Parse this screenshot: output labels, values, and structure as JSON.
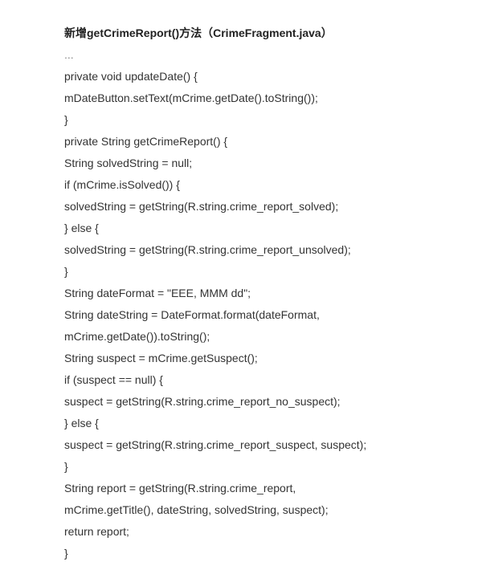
{
  "title": "新增getCrimeReport()方法（CrimeFragment.java）",
  "code": {
    "l0": "...",
    "l1": "private void updateDate() {",
    "l2": " mDateButton.setText(mCrime.getDate().toString());",
    "l3": "}",
    "l4": "private String getCrimeReport() {",
    "l5": " String solvedString = null;",
    "l6": " if (mCrime.isSolved()) {",
    "l7": " solvedString = getString(R.string.crime_report_solved);",
    "l8": " } else {",
    "l9": " solvedString = getString(R.string.crime_report_unsolved);",
    "l10": "}",
    "l11": " String dateFormat = \"EEE, MMM dd\";",
    "l12": " String dateString = DateFormat.format(dateFormat,",
    "l13": "mCrime.getDate()).toString();",
    "l14": " String suspect = mCrime.getSuspect();",
    "l15": " if (suspect == null) {",
    "l16": " suspect = getString(R.string.crime_report_no_suspect);",
    "l17": " } else {",
    "l18": " suspect = getString(R.string.crime_report_suspect, suspect);",
    "l19": " }",
    "l20": " String report = getString(R.string.crime_report,",
    "l21": " mCrime.getTitle(), dateString, solvedString, suspect);",
    "l22": " return report;",
    "l23": "}"
  }
}
